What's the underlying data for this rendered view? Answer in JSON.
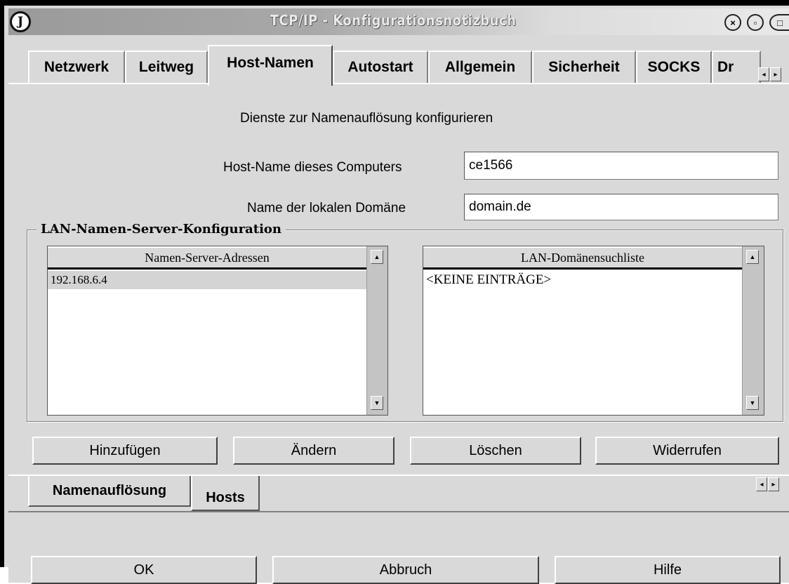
{
  "window": {
    "title": "TCP/IP - Konfigurationsnotizbuch",
    "app_icon_letter": "J"
  },
  "title_buttons": {
    "close": "×",
    "minimize": "▫",
    "maximize": "□"
  },
  "tabs": [
    {
      "label": "Netzwerk"
    },
    {
      "label": "Leitweg"
    },
    {
      "label": "Host-Namen"
    },
    {
      "label": "Autostart"
    },
    {
      "label": "Allgemein"
    },
    {
      "label": "Sicherheit"
    },
    {
      "label": "SOCKS"
    },
    {
      "label": "Dr"
    }
  ],
  "active_tab": "Host-Namen",
  "tab_scroll": {
    "left": "◂",
    "right": "▸"
  },
  "page": {
    "heading": "Dienste zur Namenauflösung konfigurieren",
    "hostname_label": "Host-Name dieses Computers",
    "hostname_value": "ce1566",
    "domain_label": "Name der lokalen Domäne",
    "domain_value": "domain.de"
  },
  "group": {
    "title": "LAN-Namen-Server-Konfiguration",
    "name_servers": {
      "header": "Namen-Server-Adressen",
      "items": [
        "192.168.6.4"
      ]
    },
    "domain_search": {
      "header": "LAN-Domänensuchliste",
      "items": [
        "<KEINE EINTRÄGE>"
      ]
    },
    "scroll_up": "▲",
    "scroll_down": "▼"
  },
  "actions": {
    "add": "Hinzufügen",
    "change": "Ändern",
    "delete": "Löschen",
    "undo": "Widerrufen"
  },
  "subtabs": [
    {
      "label": "Namenauflösung"
    },
    {
      "label": "Hosts"
    }
  ],
  "active_subtab": "Namenauflösung",
  "dialog_buttons": {
    "ok": "OK",
    "cancel": "Abbruch",
    "help": "Hilfe"
  }
}
